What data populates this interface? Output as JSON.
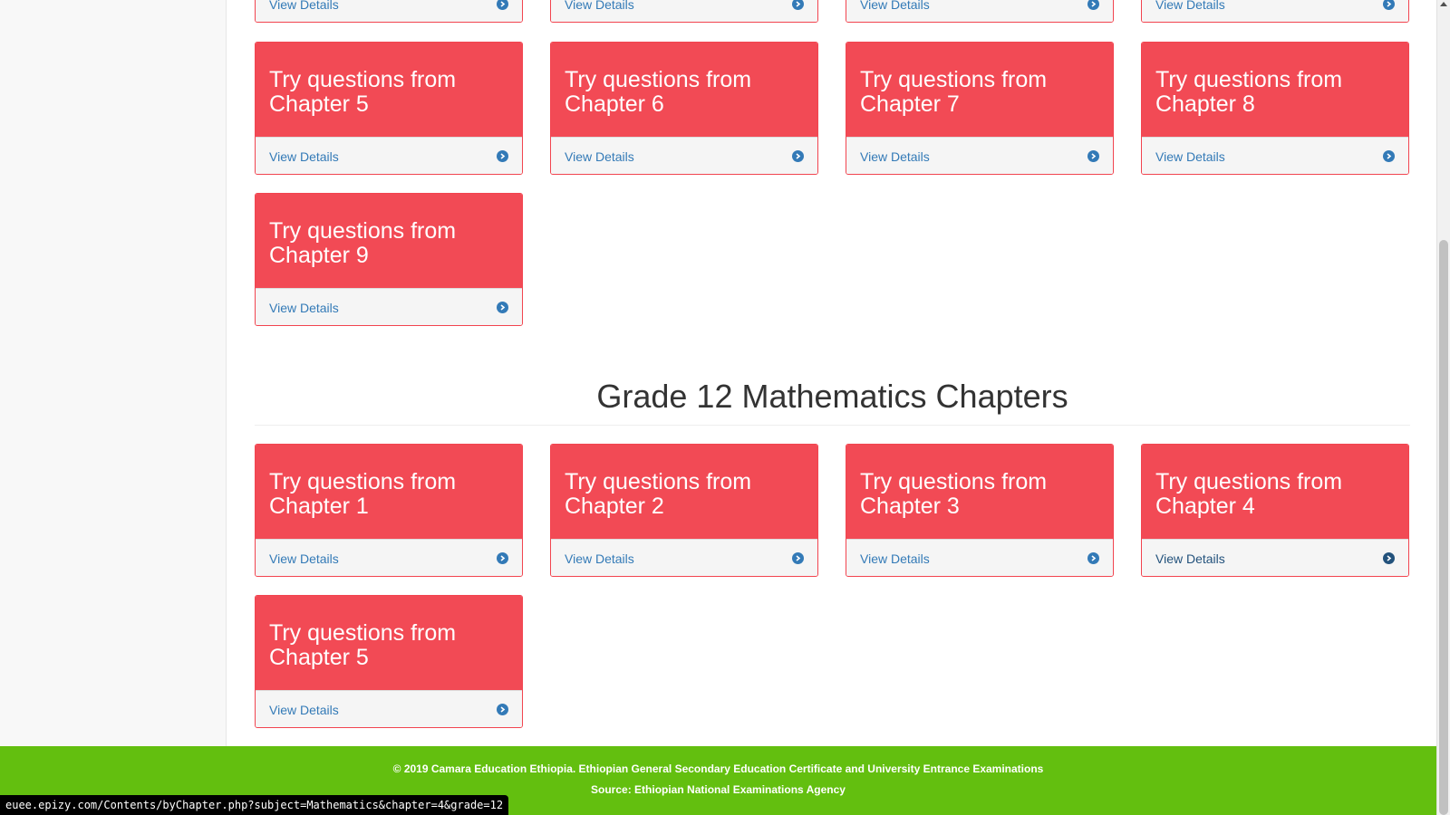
{
  "cards_top_row": [
    {
      "footer": "View Details"
    },
    {
      "footer": "View Details"
    },
    {
      "footer": "View Details"
    },
    {
      "footer": "View Details"
    }
  ],
  "section_previous": {
    "cards": [
      {
        "title": "Try questions from Chapter 5",
        "footer": "View Details"
      },
      {
        "title": "Try questions from Chapter 6",
        "footer": "View Details"
      },
      {
        "title": "Try questions from Chapter 7",
        "footer": "View Details"
      },
      {
        "title": "Try questions from Chapter 8",
        "footer": "View Details"
      },
      {
        "title": "Try questions from Chapter 9",
        "footer": "View Details"
      }
    ]
  },
  "section_grade12": {
    "title": "Grade 12 Mathematics Chapters",
    "cards": [
      {
        "title": "Try questions from Chapter 1",
        "footer": "View Details"
      },
      {
        "title": "Try questions from Chapter 2",
        "footer": "View Details"
      },
      {
        "title": "Try questions from Chapter 3",
        "footer": "View Details"
      },
      {
        "title": "Try questions from Chapter 4",
        "footer": "View Details"
      },
      {
        "title": "Try questions from Chapter 5",
        "footer": "View Details"
      }
    ]
  },
  "footer": {
    "copyright": "© 2019 Camara Education Ethiopia. Ethiopian General Secondary Education Certificate and University Entrance Examinations",
    "source": "Source: Ethiopian National Examinations Agency"
  },
  "status_bar": {
    "url": "euee.epizy.com/Contents/byChapter.php?subject=Mathematics&chapter=4&grade=12"
  },
  "colors": {
    "card_header": "#f24a55",
    "link": "#337ab7",
    "footer_bg": "#63bf0f"
  },
  "icons": {
    "card_footer": "circle-arrow-right-icon"
  }
}
